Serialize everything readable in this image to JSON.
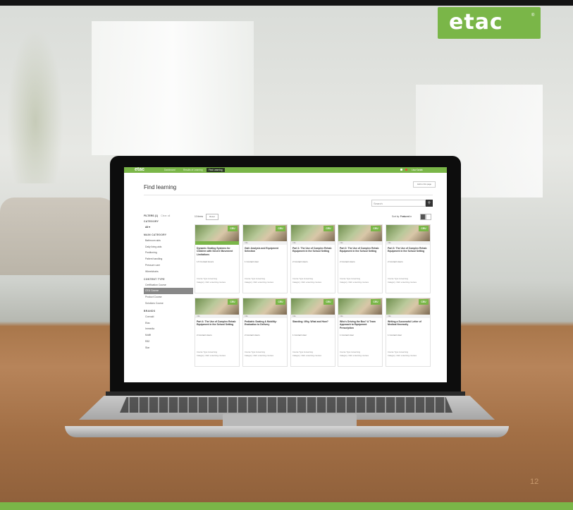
{
  "slide": {
    "logo_text": "etac",
    "logo_reg": "®",
    "page_number": "12",
    "brand_color": "#7ab648"
  },
  "app": {
    "brand": "etac",
    "nav": [
      {
        "label": "Dashboard",
        "active": false
      },
      {
        "label": "Results of Learning",
        "active": false
      },
      {
        "label": "Find Learning",
        "active": true
      }
    ],
    "user_name": "Lisa Karlak",
    "page_title": "Find learning",
    "bookmark_label": "Add to this page",
    "search_placeholder": "Search",
    "search_icon": "magnifier-icon"
  },
  "filters": {
    "header": "FILTERS (1)",
    "clear": "Clear all",
    "category_heading": "CATEGORY",
    "category_value": "All ▾",
    "main_category_heading": "MAIN CATEGORY",
    "main_category": [
      "Bathroom aids",
      "Daily living aids",
      "Positioning",
      "Patient handling",
      "Pressure care",
      "Wheelchairs"
    ],
    "content_type_heading": "CONTENT TYPE",
    "content_type": [
      {
        "label": "Certification Course",
        "selected": false
      },
      {
        "label": "CEU Course",
        "selected": true
      },
      {
        "label": "Product Course",
        "selected": false
      },
      {
        "label": "Solutions Course",
        "selected": false
      }
    ],
    "brands_heading": "BRANDS",
    "brands": [
      "Convaid",
      "Etac",
      "Immedia",
      "Molift",
      "R82",
      "Star"
    ]
  },
  "results": {
    "count": "10 items",
    "reset": "Reset",
    "sort_label": "Sort by:",
    "sort_value": "Featured ▾"
  },
  "courses": [
    {
      "title": "Dynamic Seating Systems for Children with Severe Movement Limitations",
      "hours": "1.5 Contact Hours",
      "ceu": "CEU",
      "tag": "",
      "type": "Course Type: E-learning",
      "category": "Category: CEU e-learning courses"
    },
    {
      "title": "Gait: Analysis and Equipment Selection",
      "hours": "1 Contact Hour",
      "ceu": "CEU",
      "tag": "CEL",
      "type": "Course Type: E-learning",
      "category": "Category: CEU e-learning courses"
    },
    {
      "title": "Part 1: The Use of Complex Rehab Equipment in the School Setting",
      "hours": "2 Contact Hours",
      "ceu": "CEU",
      "tag": "CEL",
      "type": "Course Type: E-learning",
      "category": "Category: CEU e-learning courses"
    },
    {
      "title": "Part 2: The Use of Complex Rehab Equipment in the School Setting",
      "hours": "2 Contact Hours",
      "ceu": "CEU",
      "tag": "CEL",
      "type": "Course Type: E-learning",
      "category": "Category: CEU e-learning courses"
    },
    {
      "title": "Part 3: The Use of Complex Rehab Equipment in the School Setting",
      "hours": "2 Contact Hours",
      "ceu": "CEU",
      "tag": "CEL",
      "type": "Course Type: E-learning",
      "category": "Category: CEU e-learning courses"
    },
    {
      "title": "Part 4: The Use of Complex Rehab Equipment in the School Setting",
      "hours": "2 Contact Hours",
      "ceu": "CEU",
      "tag": "CEL",
      "type": "Course Type: E-learning",
      "category": "Category: CEU e-learning courses"
    },
    {
      "title": "Pediatric Seating & Mobility: Evaluation to Delivery",
      "hours": "2 Contact Hours",
      "ceu": "CEU",
      "tag": "CEL",
      "type": "Course Type: E-learning",
      "category": "Category: CEU e-learning courses"
    },
    {
      "title": "Standing: Why, What and How?",
      "hours": "1 Contact Hour",
      "ceu": "CEU",
      "tag": "CEL",
      "type": "Course Type: E-learning",
      "category": "Category: CEU e-learning courses"
    },
    {
      "title": "Who's Driving the Bus? A Team Approach to Equipment Prescription",
      "hours": "1 Contact Hour",
      "ceu": "CEU",
      "tag": "CEL",
      "type": "Course Type: E-learning",
      "category": "Category: CEU e-learning courses"
    },
    {
      "title": "Writing a Successful Letter of Medical Necessity",
      "hours": "1 Contact Hour",
      "ceu": "CEU",
      "tag": "CEL",
      "type": "Course Type: E-learning",
      "category": "Category: CEU e-learning courses"
    }
  ]
}
